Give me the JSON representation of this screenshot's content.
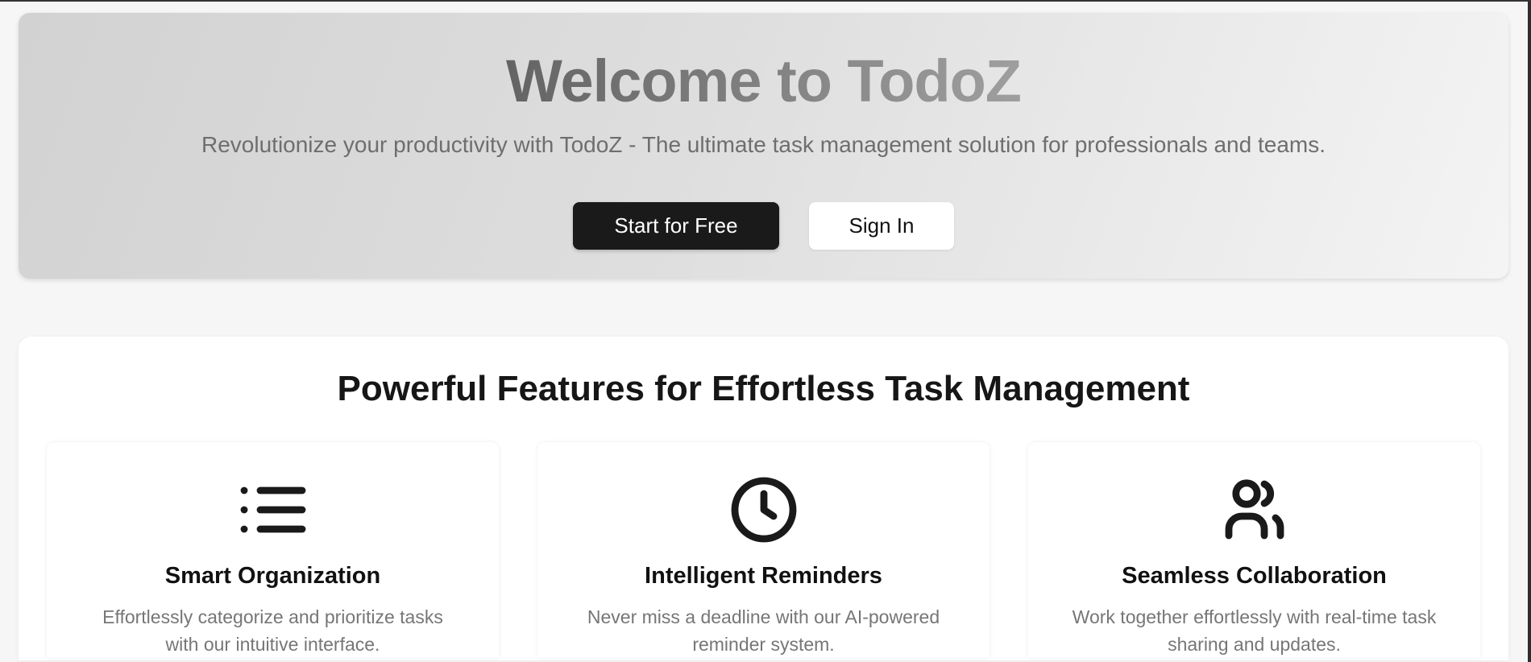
{
  "hero": {
    "title": "Welcome to TodoZ",
    "subtitle": "Revolutionize your productivity with TodoZ - The ultimate task management solution for professionals and teams.",
    "primary_button": "Start for Free",
    "secondary_button": "Sign In"
  },
  "features": {
    "heading": "Powerful Features for Effortless Task Management",
    "items": [
      {
        "icon": "list-icon",
        "title": "Smart Organization",
        "description": "Effortlessly categorize and prioritize tasks with our intuitive interface."
      },
      {
        "icon": "clock-icon",
        "title": "Intelligent Reminders",
        "description": "Never miss a deadline with our AI-powered reminder system."
      },
      {
        "icon": "users-icon",
        "title": "Seamless Collaboration",
        "description": "Work together effortlessly with real-time task sharing and updates."
      }
    ]
  }
}
